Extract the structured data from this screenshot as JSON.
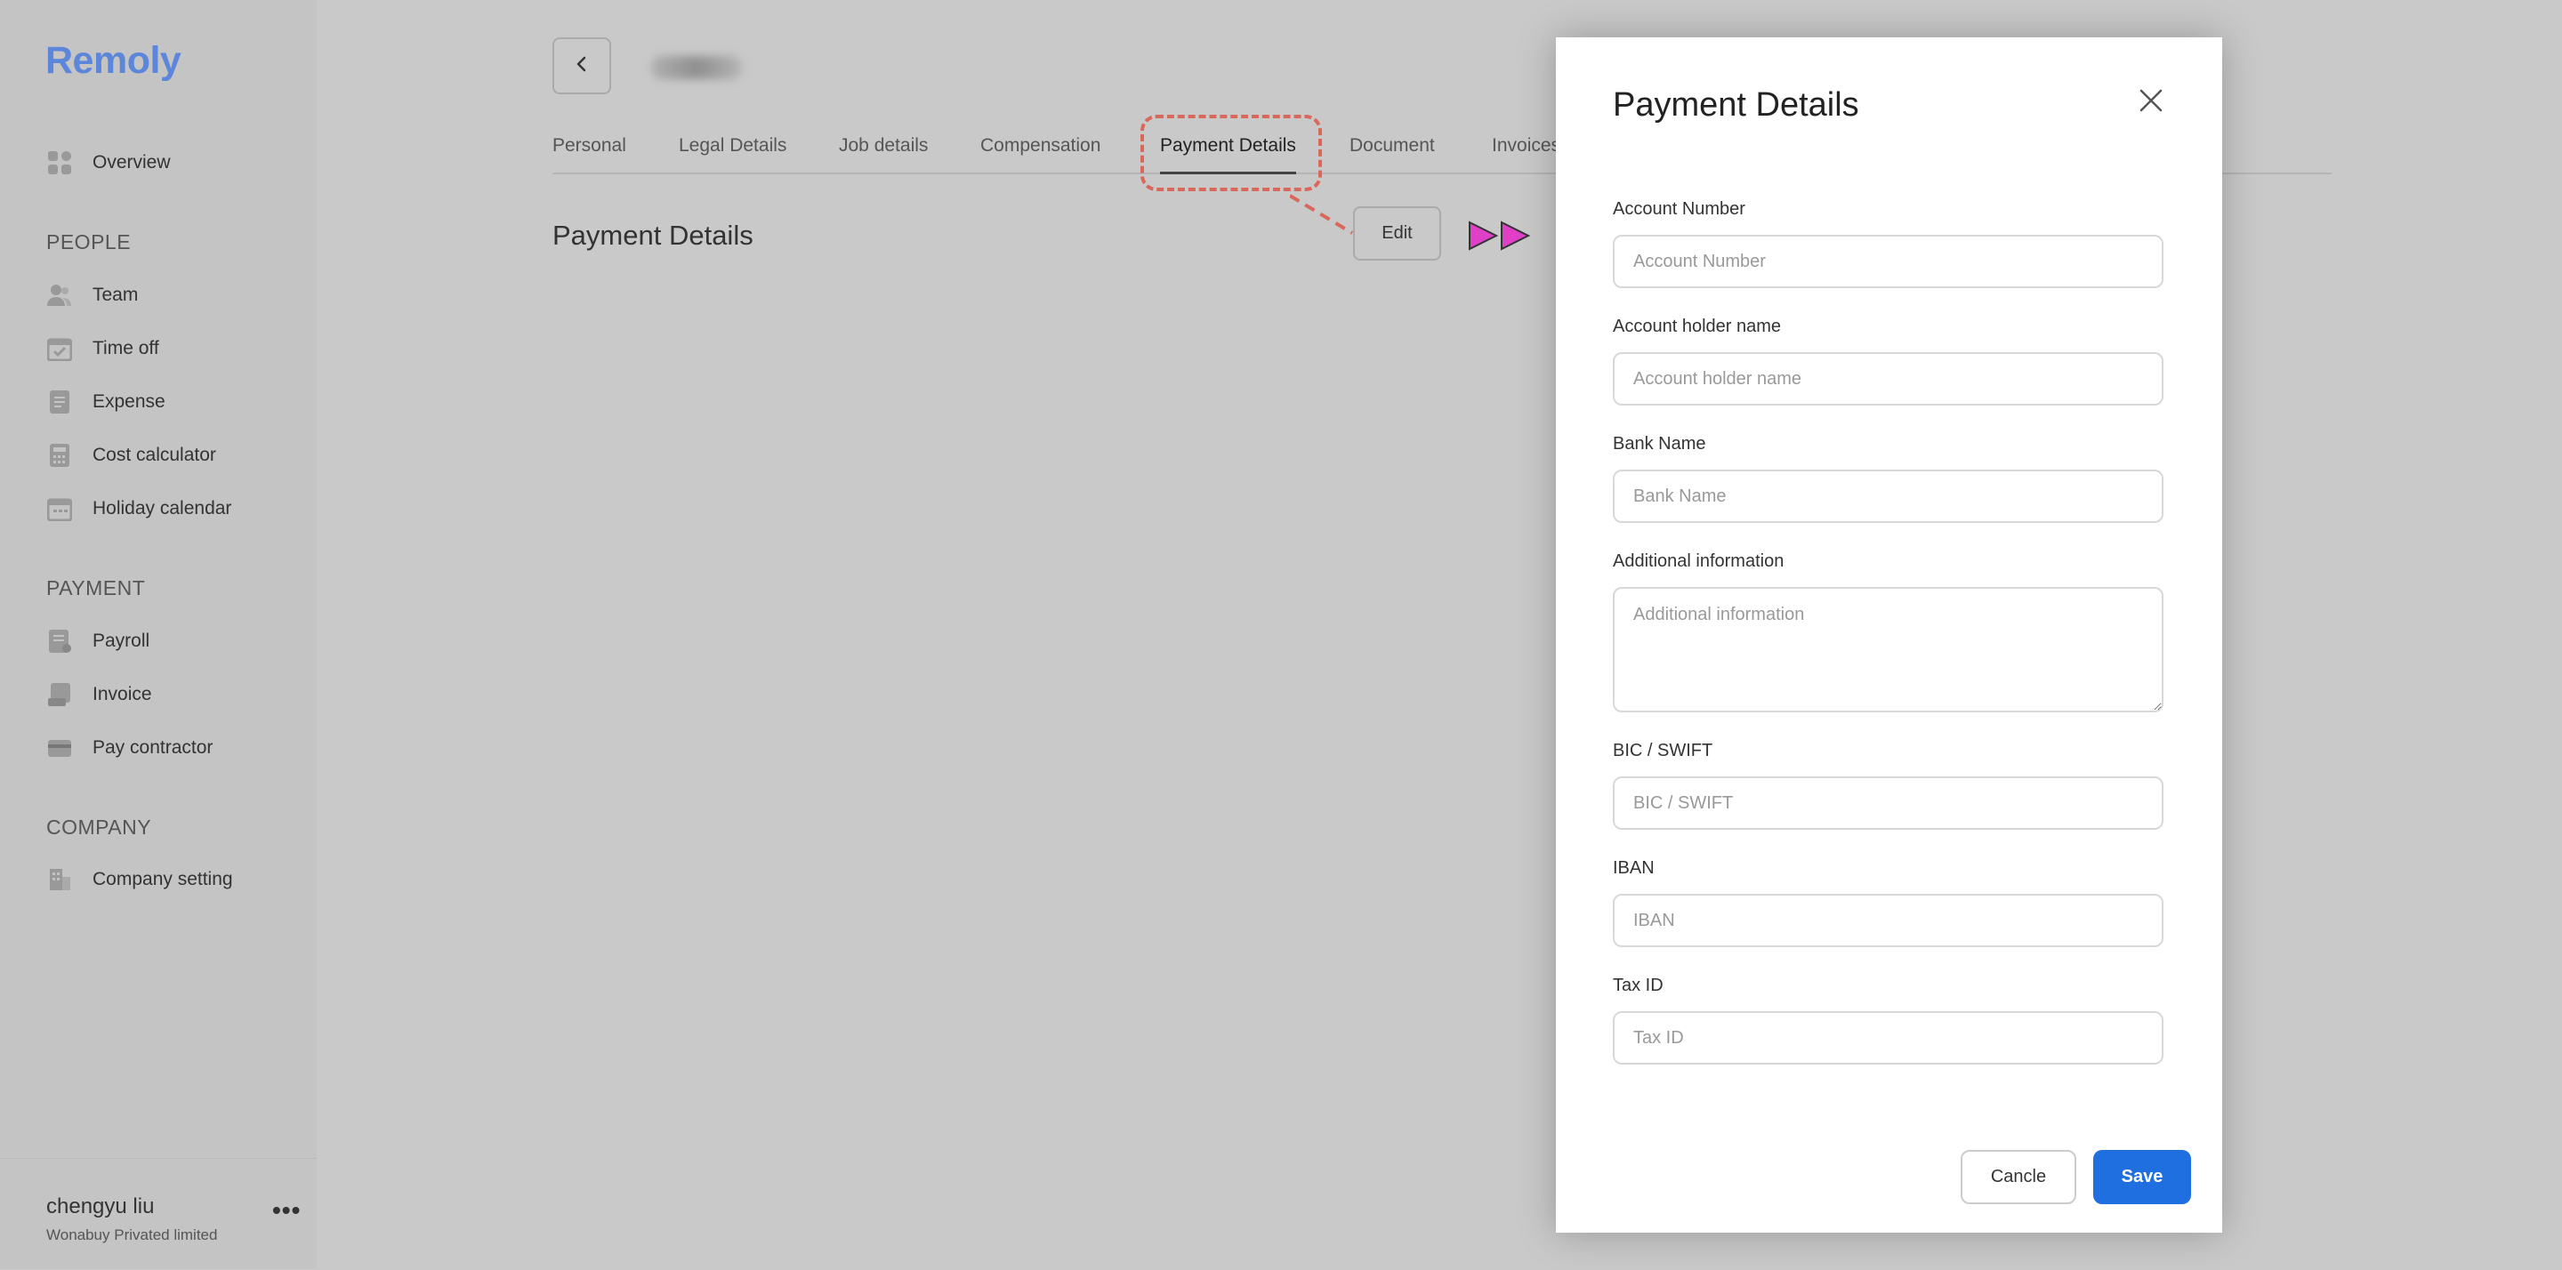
{
  "app": {
    "logo": "Remoly"
  },
  "sidebar": {
    "overview": {
      "label": "Overview",
      "icon": "dashboard-icon"
    },
    "sections": [
      {
        "title": "PEOPLE",
        "items": [
          {
            "label": "Team",
            "icon": "team-icon"
          },
          {
            "label": "Time off",
            "icon": "calendar-check-icon"
          },
          {
            "label": "Expense",
            "icon": "receipt-icon"
          },
          {
            "label": "Cost calculator",
            "icon": "calculator-icon"
          },
          {
            "label": "Holiday calendar",
            "icon": "calendar-icon"
          }
        ]
      },
      {
        "title": "PAYMENT",
        "items": [
          {
            "label": "Payroll",
            "icon": "payroll-icon"
          },
          {
            "label": "Invoice",
            "icon": "invoice-icon"
          },
          {
            "label": "Pay contractor",
            "icon": "card-icon"
          }
        ]
      },
      {
        "title": "COMPANY",
        "items": [
          {
            "label": "Company setting",
            "icon": "building-icon"
          }
        ]
      }
    ],
    "user": {
      "name": "chengyu liu",
      "org": "Wonabuy Privated limited",
      "more": "•••"
    }
  },
  "tabs": [
    {
      "label": "Personal"
    },
    {
      "label": "Legal Details"
    },
    {
      "label": "Job details"
    },
    {
      "label": "Compensation"
    },
    {
      "label": "Payment Details",
      "active": true
    },
    {
      "label": "Document"
    },
    {
      "label": "Invoices"
    }
  ],
  "main": {
    "title": "Payment Details",
    "edit_label": "Edit"
  },
  "modal": {
    "title": "Payment Details",
    "fields": {
      "account_number": {
        "label": "Account Number",
        "placeholder": "Account Number",
        "value": ""
      },
      "account_holder": {
        "label": "Account holder name",
        "placeholder": "Account holder name",
        "value": ""
      },
      "bank_name": {
        "label": "Bank Name",
        "placeholder": "Bank Name",
        "value": ""
      },
      "additional_info": {
        "label": "Additional information",
        "placeholder": "Additional information",
        "value": ""
      },
      "bic_swift": {
        "label": "BIC / SWIFT",
        "placeholder": "BIC / SWIFT",
        "value": ""
      },
      "iban": {
        "label": "IBAN",
        "placeholder": "IBAN",
        "value": ""
      },
      "tax_id": {
        "label": "Tax ID",
        "placeholder": "Tax ID",
        "value": ""
      }
    },
    "cancel_label": "Cancle",
    "save_label": "Save"
  },
  "colors": {
    "brand": "#5b86d9",
    "primary_button": "#1f6fe0",
    "annotation": "#d9685b",
    "marker": "#e040c8"
  }
}
